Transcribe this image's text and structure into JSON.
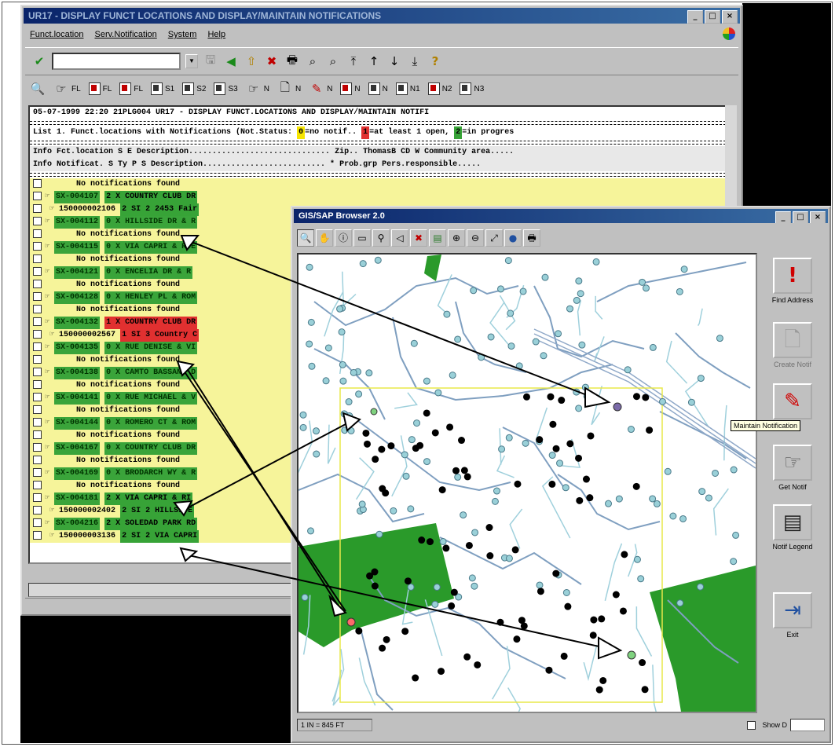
{
  "sap": {
    "title": "UR17 - DISPLAY FUNCT LOCATIONS AND DISPLAY/MAINTAIN NOTIFICATIONS",
    "menu": [
      "Funct.location",
      "Serv.Notification",
      "System",
      "Help"
    ],
    "toolbar2": [
      "FL",
      "FL",
      "FL",
      "S1",
      "S2",
      "S3",
      "N",
      "N",
      "N",
      "N",
      "N",
      "N1",
      "N2",
      "N3"
    ],
    "header_line": "05-07-1999  22:20  21PLG004          UR17 - DISPLAY FUNCT.LOCATIONS AND DISPLAY/MAINTAIN NOTIFI",
    "list_title": "List 1. Funct.locations with Notifications (Not.Status:",
    "legend": {
      "yellow_code": "0",
      "yellow_text": "=no notif..",
      "red_code": "1",
      "red_text": "=at least 1 open,",
      "green_code": "2",
      "green_text": "=in progres"
    },
    "col_header1": "Info Fct.location   S E Description.............................. Zip.. ThomasB CD W Community area.....",
    "col_header2": "  Info Notificat.   S Ty  P S Description.......................... * Prob.grp Pers.responsible.....",
    "rows": [
      {
        "kind": "none",
        "text": "No notifications found"
      },
      {
        "kind": "fl",
        "id": "SX-004107",
        "status": "2 X COUNTRY CLUB DR"
      },
      {
        "kind": "notif",
        "id": "150000002106",
        "status": "2 SI  2   2453 Fair"
      },
      {
        "kind": "fl",
        "id": "SX-004112",
        "status": "0 X HILLSIDE DR & R"
      },
      {
        "kind": "none",
        "text": "No notifications found"
      },
      {
        "kind": "fl",
        "id": "SX-004115",
        "status": "0 X VIA CAPRI & RUE"
      },
      {
        "kind": "none",
        "text": "No notifications found"
      },
      {
        "kind": "fl",
        "id": "SX-004121",
        "status": "0 X ENCELIA DR & R"
      },
      {
        "kind": "none",
        "text": "No notifications found"
      },
      {
        "kind": "fl",
        "id": "SX-004128",
        "status": "0 X HENLEY PL & ROM"
      },
      {
        "kind": "none",
        "text": "No notifications found"
      },
      {
        "kind": "fl",
        "id": "SX-004132",
        "status": "1 X COUNTRY CLUB DR"
      },
      {
        "kind": "notif",
        "id": "150000002567",
        "status": "1 SI  3   Country C"
      },
      {
        "kind": "fl",
        "id": "SX-004135",
        "status": "0 X RUE DENISE & VI"
      },
      {
        "kind": "none",
        "text": "No notifications found"
      },
      {
        "kind": "fl",
        "id": "SX-004138",
        "status": "0 X CAMTO BASSANO D"
      },
      {
        "kind": "none",
        "text": "No notifications found"
      },
      {
        "kind": "fl",
        "id": "SX-004141",
        "status": "0 X RUE MICHAEL & V"
      },
      {
        "kind": "none",
        "text": "No notifications found"
      },
      {
        "kind": "fl",
        "id": "SX-004144",
        "status": "0 X ROMERO CT & ROM"
      },
      {
        "kind": "none",
        "text": "No notifications found"
      },
      {
        "kind": "fl",
        "id": "SX-004167",
        "status": "0 X COUNTRY CLUB DR"
      },
      {
        "kind": "none",
        "text": "No notifications found"
      },
      {
        "kind": "fl",
        "id": "SX-004169",
        "status": "0 X BRODARCH WY & R"
      },
      {
        "kind": "none",
        "text": "No notifications found"
      },
      {
        "kind": "fl",
        "id": "SX-004181",
        "status": "2 X VIA CAPRI & RI"
      },
      {
        "kind": "notif",
        "id": "150000002402",
        "status": "2 SI  2   HILLSIDE"
      },
      {
        "kind": "fl",
        "id": "SX-004216",
        "status": "2 X SOLEDAD PARK RD"
      },
      {
        "kind": "notif",
        "id": "150000003136",
        "status": "2 SI  2   VIA CAPRI"
      }
    ]
  },
  "gis": {
    "title": "GIS/SAP Browser 2.0",
    "buttons": [
      "Find Address",
      "Create Notif",
      "Maintain Notification",
      "Get Notif",
      "Notif Legend",
      "Exit"
    ],
    "tooltip": "Maintain Notification",
    "scale": "1 IN = 845 FT",
    "show_label": "Show D",
    "colors": {
      "parcel": "#2a9a2a",
      "pipe": "#7f9fc0",
      "node": "#9ad0d8",
      "asset": "#000000",
      "selection": "#e8e84a"
    }
  }
}
